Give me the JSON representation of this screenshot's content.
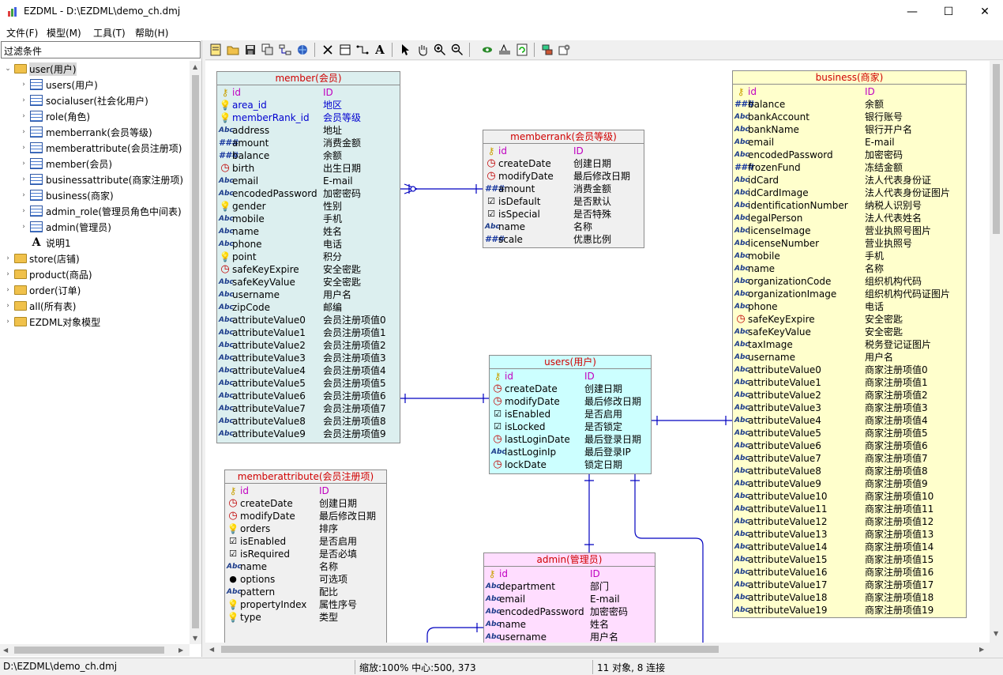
{
  "window": {
    "title": "EZDML - D:\\EZDML\\demo_ch.dmj",
    "minimize": "—",
    "maximize": "☐",
    "close": "✕"
  },
  "menu": [
    "文件(F)",
    "模型(M)",
    "工具(T)",
    "帮助(H)"
  ],
  "filter": {
    "label": "过滤条件"
  },
  "tree": {
    "user_folder": "user(用户)",
    "user_tables": [
      "users(用户)",
      "socialuser(社会化用户)",
      "role(角色)",
      "memberrank(会员等级)",
      "memberattribute(会员注册项)",
      "member(会员)",
      "businessattribute(商家注册项)",
      "business(商家)",
      "admin_role(管理员角色中间表)",
      "admin(管理员)"
    ],
    "user_label": "说明1",
    "folders": [
      "store(店铺)",
      "product(商品)",
      "order(订单)",
      "all(所有表)",
      "EZDML对象模型"
    ]
  },
  "entities": {
    "member": {
      "title": "member(会员)",
      "fields": [
        [
          "pk",
          "id",
          "ID"
        ],
        [
          "fk",
          "area_id",
          "地区"
        ],
        [
          "fk",
          "memberRank_id",
          "会员等级"
        ],
        [
          "abc",
          "address",
          "地址"
        ],
        [
          "num",
          "amount",
          "消费金额"
        ],
        [
          "num",
          "balance",
          "余额"
        ],
        [
          "date",
          "birth",
          "出生日期"
        ],
        [
          "abc",
          "email",
          "E-mail"
        ],
        [
          "abc",
          "encodedPassword",
          "加密密码"
        ],
        [
          "key",
          "gender",
          "性别"
        ],
        [
          "abc",
          "mobile",
          "手机"
        ],
        [
          "abc",
          "name",
          "姓名"
        ],
        [
          "abc",
          "phone",
          "电话"
        ],
        [
          "key",
          "point",
          "积分"
        ],
        [
          "date",
          "safeKeyExpire",
          "安全密匙"
        ],
        [
          "abc",
          "safeKeyValue",
          "安全密匙"
        ],
        [
          "abc",
          "username",
          "用户名"
        ],
        [
          "abc",
          "zipCode",
          "邮编"
        ],
        [
          "abc",
          "attributeValue0",
          "会员注册项值0"
        ],
        [
          "abc",
          "attributeValue1",
          "会员注册项值1"
        ],
        [
          "abc",
          "attributeValue2",
          "会员注册项值2"
        ],
        [
          "abc",
          "attributeValue3",
          "会员注册项值3"
        ],
        [
          "abc",
          "attributeValue4",
          "会员注册项值4"
        ],
        [
          "abc",
          "attributeValue5",
          "会员注册项值5"
        ],
        [
          "abc",
          "attributeValue6",
          "会员注册项值6"
        ],
        [
          "abc",
          "attributeValue7",
          "会员注册项值7"
        ],
        [
          "abc",
          "attributeValue8",
          "会员注册项值8"
        ],
        [
          "abc",
          "attributeValue9",
          "会员注册项值9"
        ]
      ]
    },
    "memberrank": {
      "title": "memberrank(会员等级)",
      "fields": [
        [
          "pk",
          "id",
          "ID"
        ],
        [
          "date",
          "createDate",
          "创建日期"
        ],
        [
          "date",
          "modifyDate",
          "最后修改日期"
        ],
        [
          "num",
          "amount",
          "消费金额"
        ],
        [
          "bool",
          "isDefault",
          "是否默认"
        ],
        [
          "bool",
          "isSpecial",
          "是否特殊"
        ],
        [
          "abc",
          "name",
          "名称"
        ],
        [
          "num",
          "scale",
          "优惠比例"
        ]
      ]
    },
    "users": {
      "title": "users(用户)",
      "fields": [
        [
          "pk",
          "id",
          "ID"
        ],
        [
          "date",
          "createDate",
          "创建日期"
        ],
        [
          "date",
          "modifyDate",
          "最后修改日期"
        ],
        [
          "bool",
          "isEnabled",
          "是否启用"
        ],
        [
          "bool",
          "isLocked",
          "是否锁定"
        ],
        [
          "date",
          "lastLoginDate",
          "最后登录日期"
        ],
        [
          "abc",
          "lastLoginIp",
          "最后登录IP"
        ],
        [
          "date",
          "lockDate",
          "锁定日期"
        ]
      ]
    },
    "memberattribute": {
      "title": "memberattribute(会员注册项)",
      "fields": [
        [
          "pk",
          "id",
          "ID"
        ],
        [
          "date",
          "createDate",
          "创建日期"
        ],
        [
          "date",
          "modifyDate",
          "最后修改日期"
        ],
        [
          "key",
          "orders",
          "排序"
        ],
        [
          "bool",
          "isEnabled",
          "是否启用"
        ],
        [
          "bool",
          "isRequired",
          "是否必填"
        ],
        [
          "abc",
          "name",
          "名称"
        ],
        [
          "obj",
          "options",
          "可选项"
        ],
        [
          "abc",
          "pattern",
          "配比"
        ],
        [
          "key",
          "propertyIndex",
          "属性序号"
        ],
        [
          "key",
          "type",
          "类型"
        ]
      ]
    },
    "admin": {
      "title": "admin(管理员)",
      "fields": [
        [
          "pk",
          "id",
          "ID"
        ],
        [
          "abc",
          "department",
          "部门"
        ],
        [
          "abc",
          "email",
          "E-mail"
        ],
        [
          "abc",
          "encodedPassword",
          "加密密码"
        ],
        [
          "abc",
          "name",
          "姓名"
        ],
        [
          "abc",
          "username",
          "用户名"
        ]
      ]
    },
    "business": {
      "title": "business(商家)",
      "fields": [
        [
          "pk",
          "id",
          "ID"
        ],
        [
          "num",
          "balance",
          "余额"
        ],
        [
          "abc",
          "bankAccount",
          "银行账号"
        ],
        [
          "abc",
          "bankName",
          "银行开户名"
        ],
        [
          "abc",
          "email",
          "E-mail"
        ],
        [
          "abc",
          "encodedPassword",
          "加密密码"
        ],
        [
          "num",
          "frozenFund",
          "冻结金额"
        ],
        [
          "abc",
          "idCard",
          "法人代表身份证"
        ],
        [
          "abc",
          "idCardImage",
          "法人代表身份证图片"
        ],
        [
          "abc",
          "identificationNumber",
          "纳税人识别号"
        ],
        [
          "abc",
          "legalPerson",
          "法人代表姓名"
        ],
        [
          "abc",
          "licenseImage",
          "营业执照号图片"
        ],
        [
          "abc",
          "licenseNumber",
          "营业执照号"
        ],
        [
          "abc",
          "mobile",
          "手机"
        ],
        [
          "abc",
          "name",
          "名称"
        ],
        [
          "abc",
          "organizationCode",
          "组织机构代码"
        ],
        [
          "abc",
          "organizationImage",
          "组织机构代码证图片"
        ],
        [
          "abc",
          "phone",
          "电话"
        ],
        [
          "date",
          "safeKeyExpire",
          "安全密匙"
        ],
        [
          "abc",
          "safeKeyValue",
          "安全密匙"
        ],
        [
          "abc",
          "taxImage",
          "税务登记证图片"
        ],
        [
          "abc",
          "username",
          "用户名"
        ],
        [
          "abc",
          "attributeValue0",
          "商家注册项值0"
        ],
        [
          "abc",
          "attributeValue1",
          "商家注册项值1"
        ],
        [
          "abc",
          "attributeValue2",
          "商家注册项值2"
        ],
        [
          "abc",
          "attributeValue3",
          "商家注册项值3"
        ],
        [
          "abc",
          "attributeValue4",
          "商家注册项值4"
        ],
        [
          "abc",
          "attributeValue5",
          "商家注册项值5"
        ],
        [
          "abc",
          "attributeValue6",
          "商家注册项值6"
        ],
        [
          "abc",
          "attributeValue7",
          "商家注册项值7"
        ],
        [
          "abc",
          "attributeValue8",
          "商家注册项值8"
        ],
        [
          "abc",
          "attributeValue9",
          "商家注册项值9"
        ],
        [
          "abc",
          "attributeValue10",
          "商家注册项值10"
        ],
        [
          "abc",
          "attributeValue11",
          "商家注册项值11"
        ],
        [
          "abc",
          "attributeValue12",
          "商家注册项值12"
        ],
        [
          "abc",
          "attributeValue13",
          "商家注册项值13"
        ],
        [
          "abc",
          "attributeValue14",
          "商家注册项值14"
        ],
        [
          "abc",
          "attributeValue15",
          "商家注册项值15"
        ],
        [
          "abc",
          "attributeValue16",
          "商家注册项值16"
        ],
        [
          "abc",
          "attributeValue17",
          "商家注册项值17"
        ],
        [
          "abc",
          "attributeValue18",
          "商家注册项值18"
        ],
        [
          "abc",
          "attributeValue19",
          "商家注册项值19"
        ]
      ]
    }
  },
  "colors": {
    "member": "#dcefef",
    "memberrank": "#f0f0f0",
    "users": "#ccffff",
    "memberattribute": "#f0f0f0",
    "admin": "#ffddff",
    "business": "#ffffcc",
    "link": "#0000c0",
    "title": "#d00000"
  },
  "status": {
    "path": "D:\\EZDML\\demo_ch.dmj",
    "zoom": "缩放:100% 中心:500, 373",
    "counts": "11 对象, 8 连接"
  }
}
